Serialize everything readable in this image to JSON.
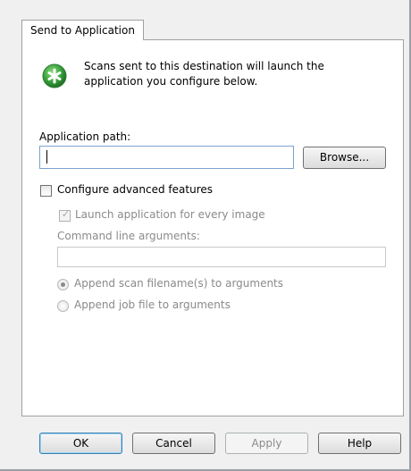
{
  "tab": {
    "label": "Send to Application"
  },
  "info": {
    "icon": "green-star-icon",
    "text": "Scans sent to this destination will launch the application you configure below."
  },
  "application_path": {
    "label": "Application path:",
    "value": "",
    "browse_label": "Browse..."
  },
  "advanced": {
    "label": "Configure advanced features",
    "checked": false,
    "launch_label": "Launch application for every image",
    "launch_checked": true,
    "command_line_label": "Command line arguments:",
    "command_line_value": "",
    "radio_scan_label": "Append scan filename(s) to arguments",
    "radio_scan_selected": true,
    "radio_job_label": "Append job file to arguments",
    "radio_job_selected": false
  },
  "buttons": {
    "ok": "OK",
    "cancel": "Cancel",
    "apply": "Apply",
    "help": "Help"
  },
  "colors": {
    "icon_green": "#3aa23f",
    "window_bg": "#f0f0f0",
    "input_border_focus": "#7aa3cf",
    "disabled_text": "#8a8a8a"
  }
}
